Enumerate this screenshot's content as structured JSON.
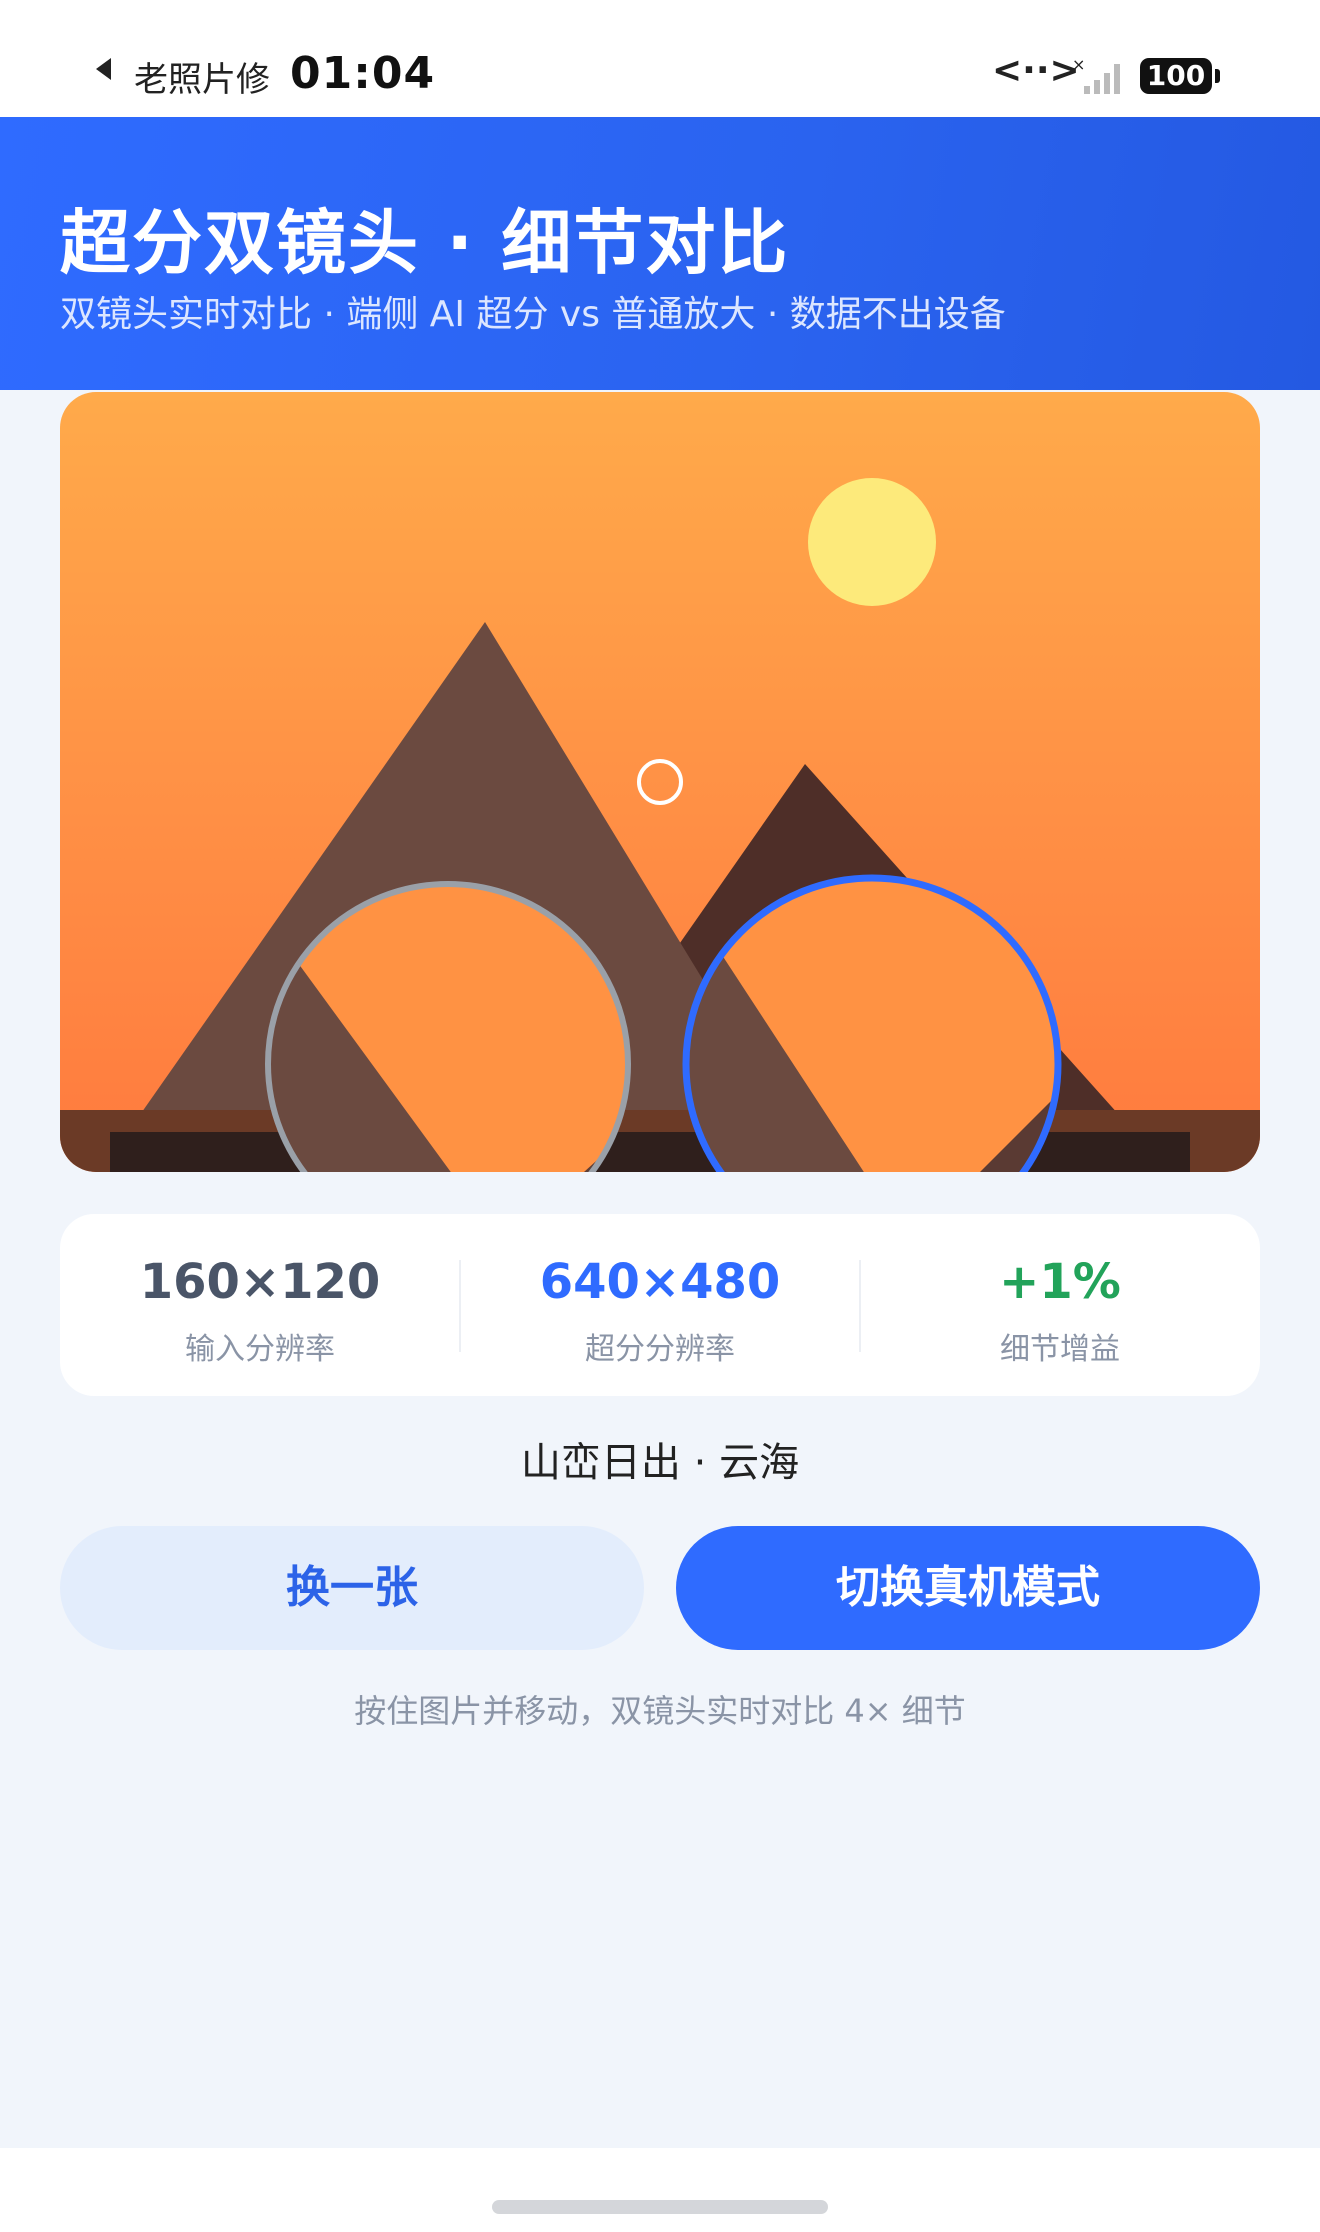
{
  "status_bar": {
    "back_app": "老照片修",
    "time": "01:04",
    "network": "<··>",
    "battery": "100"
  },
  "header": {
    "title": "超分双镜头 · 细节对比",
    "subtitle": "双镜头实时对比 · 端侧 AI 超分 vs 普通放大 · 数据不出设备"
  },
  "colors": {
    "accent": "#2f6bff",
    "input_res": "#4a5568",
    "output_res": "#2f6bff",
    "gain": "#22a35a"
  },
  "stats": [
    {
      "value": "160×120",
      "label": "输入分辨率"
    },
    {
      "value": "640×480",
      "label": "超分分辨率"
    },
    {
      "value": "+1%",
      "label": "细节增益"
    }
  ],
  "caption": "山峦日出 · 云海",
  "buttons": {
    "change": "换一张",
    "switch_mode": "切换真机模式"
  },
  "hint": "按住图片并移动，双镜头实时对比 4× 细节"
}
